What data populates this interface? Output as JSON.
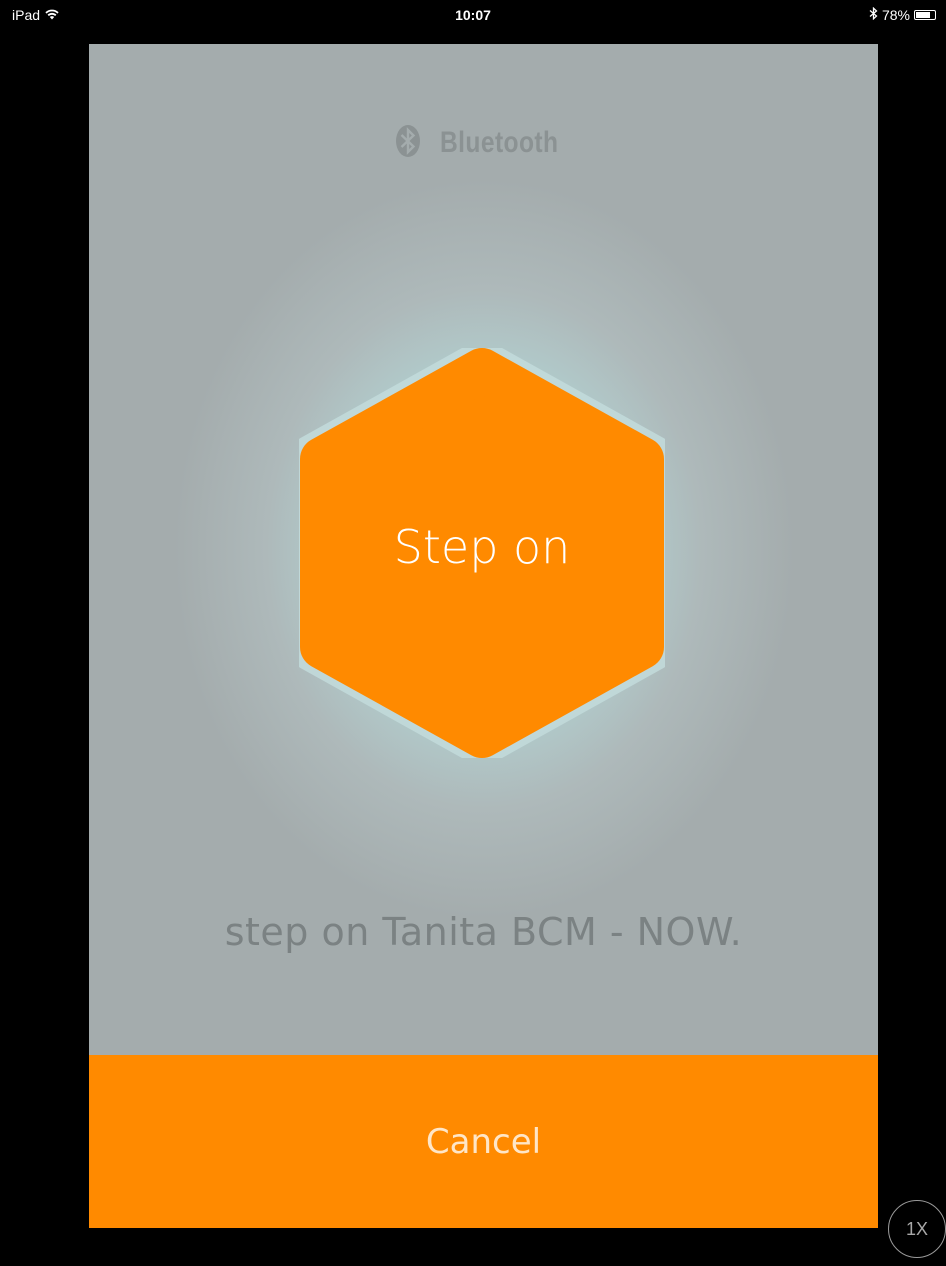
{
  "status_bar": {
    "device": "iPad",
    "wifi_icon": "wifi-icon",
    "time": "10:07",
    "bluetooth_icon": "bluetooth-icon",
    "battery_percent": "78%",
    "battery_level": 0.78
  },
  "brand": {
    "logo_icon": "bluetooth-logo-icon",
    "text": "Bluetooth"
  },
  "hexagon": {
    "label": "Step on",
    "color": "#ff8a00"
  },
  "prompt": {
    "text": "step on Tanita BCM - NOW."
  },
  "cancel": {
    "label": "Cancel",
    "color": "#ff8a00"
  },
  "speed_toggle": {
    "label": "1X"
  }
}
